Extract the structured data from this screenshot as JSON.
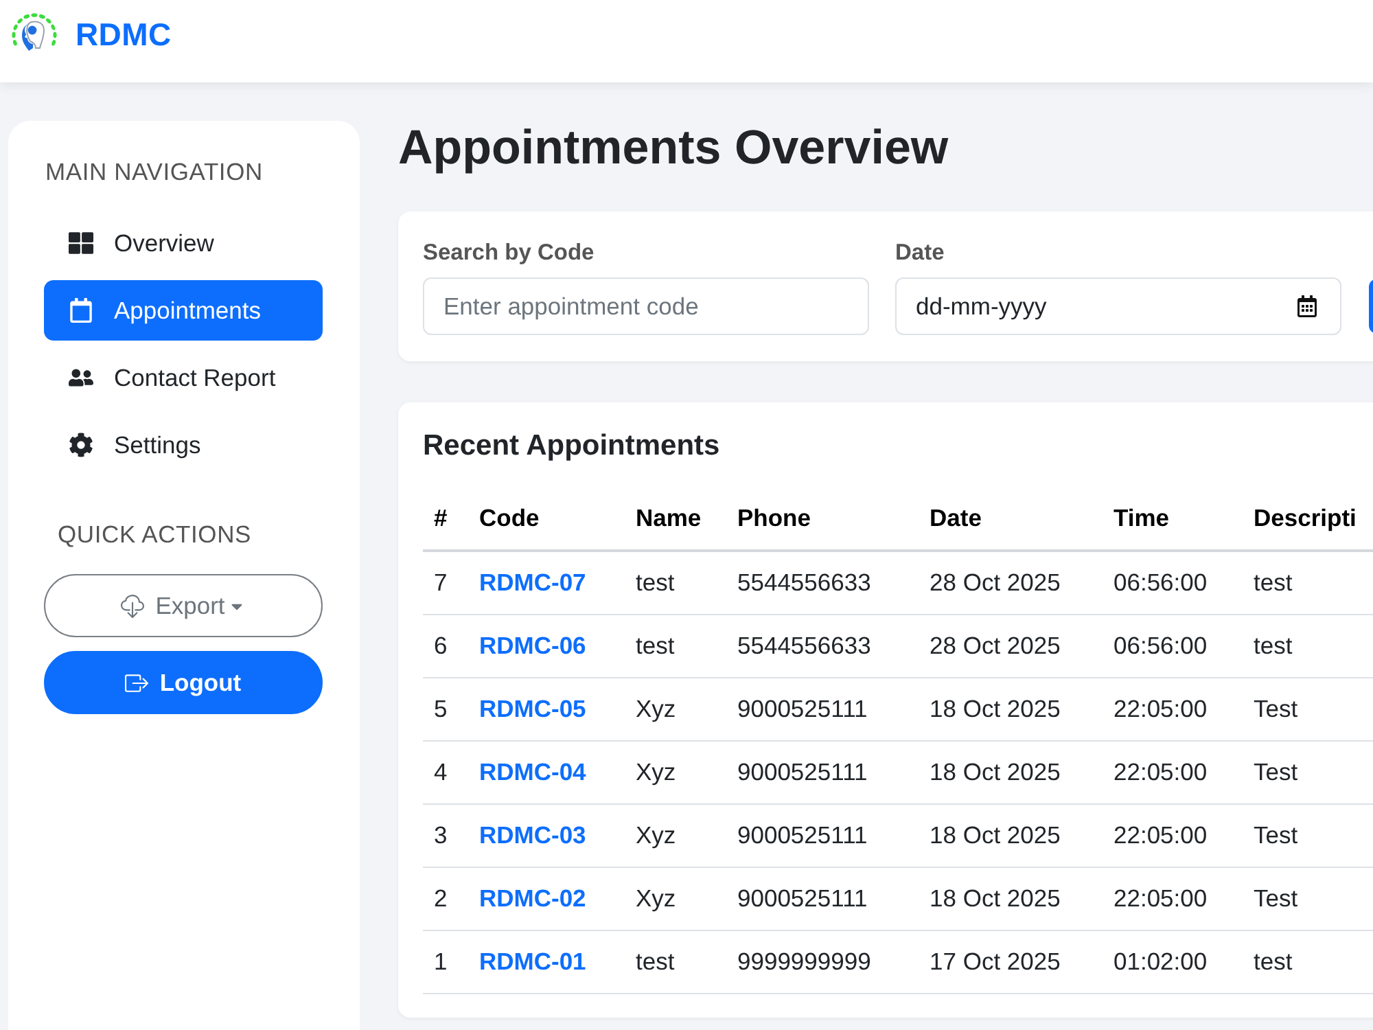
{
  "header": {
    "brand": "RDMC"
  },
  "sidebar": {
    "nav_title": "MAIN NAVIGATION",
    "nav": [
      {
        "label": "Overview",
        "selected": false
      },
      {
        "label": "Appointments",
        "selected": true
      },
      {
        "label": "Contact Report",
        "selected": false
      },
      {
        "label": "Settings",
        "selected": false
      }
    ],
    "actions_title": "QUICK ACTIONS",
    "actions": [
      {
        "label": "Export",
        "kind": "dropdown"
      },
      {
        "label": "Logout",
        "kind": "primary"
      }
    ]
  },
  "page_title": "Appointments Overview",
  "filters": {
    "fields": [
      {
        "label": "Search by Code",
        "kind": "text",
        "placeholder": "Enter appointment code"
      },
      {
        "label": "Date",
        "kind": "date",
        "placeholder": "dd-mm-yyyy"
      }
    ]
  },
  "table": {
    "title": "Recent Appointments",
    "columns": [
      {
        "label": "#",
        "kind": "text"
      },
      {
        "label": "Code",
        "kind": "link"
      },
      {
        "label": "Name",
        "kind": "text"
      },
      {
        "label": "Phone",
        "kind": "text"
      },
      {
        "label": "Date",
        "kind": "text"
      },
      {
        "label": "Time",
        "kind": "text"
      },
      {
        "label": "Descripti",
        "kind": "text"
      }
    ],
    "rows": [
      [
        "7",
        "RDMC-07",
        "test",
        "5544556633",
        "28 Oct 2025",
        "06:56:00",
        "test"
      ],
      [
        "6",
        "RDMC-06",
        "test",
        "5544556633",
        "28 Oct 2025",
        "06:56:00",
        "test"
      ],
      [
        "5",
        "RDMC-05",
        "Xyz",
        "9000525111",
        "18 Oct 2025",
        "22:05:00",
        "Test"
      ],
      [
        "4",
        "RDMC-04",
        "Xyz",
        "9000525111",
        "18 Oct 2025",
        "22:05:00",
        "Test"
      ],
      [
        "3",
        "RDMC-03",
        "Xyz",
        "9000525111",
        "18 Oct 2025",
        "22:05:00",
        "Test"
      ],
      [
        "2",
        "RDMC-02",
        "Xyz",
        "9000525111",
        "18 Oct 2025",
        "22:05:00",
        "Test"
      ],
      [
        "1",
        "RDMC-01",
        "test",
        "9999999999",
        "17 Oct 2025",
        "01:02:00",
        "test"
      ]
    ]
  }
}
